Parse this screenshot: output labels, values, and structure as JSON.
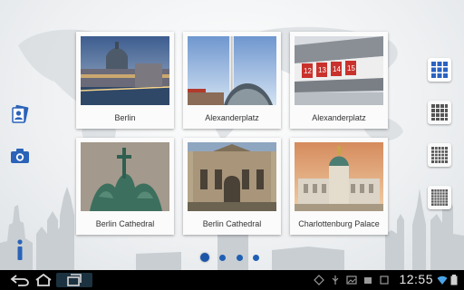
{
  "gallery": {
    "cards": [
      {
        "label": "Berlin"
      },
      {
        "label": "Alexanderplatz"
      },
      {
        "label": "Alexanderplatz"
      },
      {
        "label": "Berlin Cathedral"
      },
      {
        "label": "Berlin Cathedral"
      },
      {
        "label": "Charlottenburg Palace"
      }
    ],
    "clock_sign_numbers": "12 13 14 15"
  },
  "pager": {
    "pages": 4,
    "current": 1
  },
  "status_bar": {
    "time": "12:55"
  },
  "icons": {
    "left": [
      "contacts-icon",
      "camera-icon",
      "info-icon"
    ],
    "right": [
      "grid-3x3-icon",
      "grid-4x4-icon",
      "grid-5x5-icon",
      "grid-6x6-icon"
    ],
    "nav": [
      "back-icon",
      "home-icon",
      "recent-apps-icon"
    ]
  },
  "colors": {
    "accent": "#1d55a8",
    "system_bar": "#000000"
  }
}
